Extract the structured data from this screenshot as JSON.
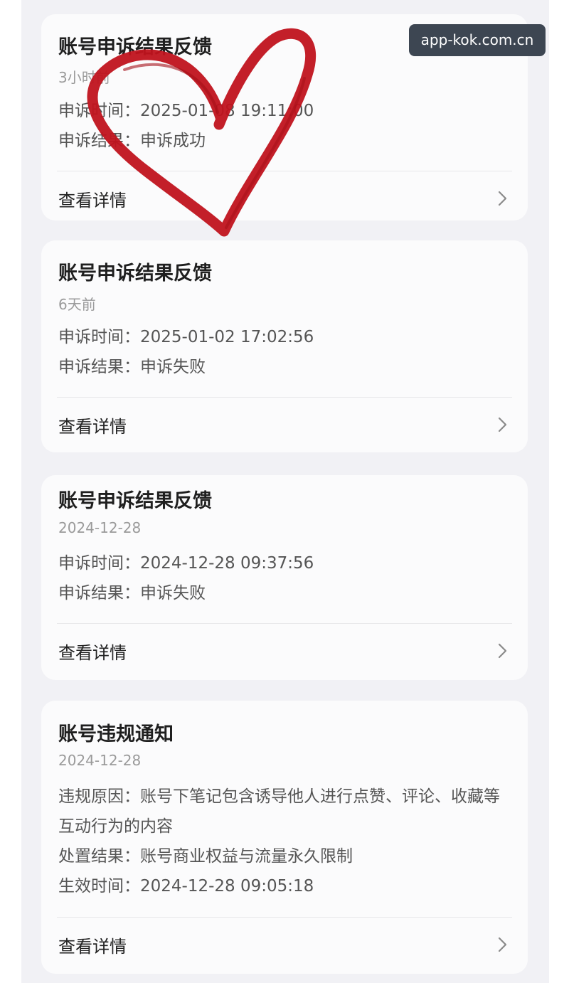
{
  "watermark": {
    "text": "app-kok.com.cn"
  },
  "notifications": [
    {
      "title": "账号申诉结果反馈",
      "time": "3小时前",
      "lines": [
        "申诉时间：2025-01-08 19:11:00",
        "申诉结果：申诉成功"
      ],
      "action_label": "查看详情"
    },
    {
      "title": "账号申诉结果反馈",
      "time": "6天前",
      "lines": [
        "申诉时间：2025-01-02 17:02:56",
        "申诉结果：申诉失败"
      ],
      "action_label": "查看详情"
    },
    {
      "title": "账号申诉结果反馈",
      "time": "2024-12-28",
      "lines": [
        "申诉时间：2024-12-28 09:37:56",
        "申诉结果：申诉失败"
      ],
      "action_label": "查看详情"
    },
    {
      "title": "账号违规通知",
      "time": "2024-12-28",
      "lines": [
        "违规原因：账号下笔记包含诱导他人进行点赞、评论、收藏等互动行为的内容",
        "处置结果：账号商业权益与流量永久限制",
        "生效时间：2024-12-28 09:05:18"
      ],
      "action_label": "查看详情"
    }
  ],
  "colors": {
    "page_background": "#f1f1f5",
    "card_background": "#fbfbfc",
    "heart": "#c0131e",
    "watermark_background": "#3d4652"
  },
  "icons": {
    "chevron": "chevron-right-icon",
    "overlay": "heart-doodle"
  }
}
